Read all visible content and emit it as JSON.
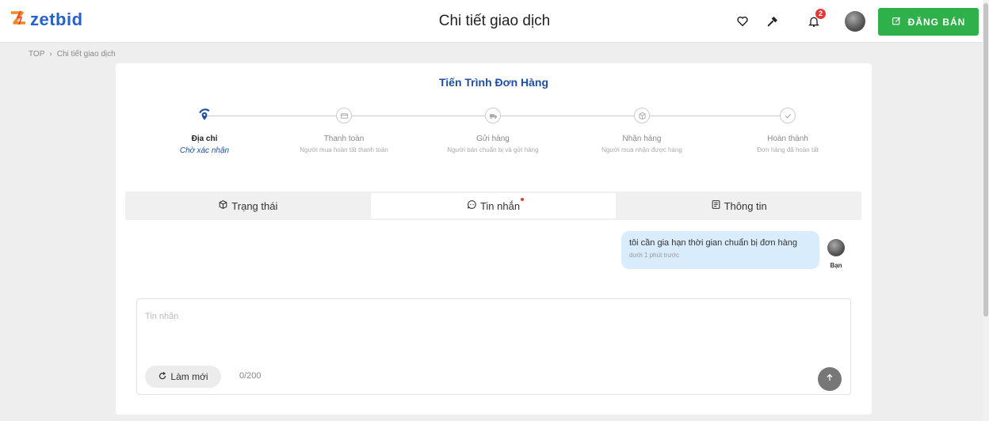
{
  "header": {
    "logo_text": "zetbid",
    "title": "Chi tiết giao dịch",
    "notification_count": "2",
    "sell_button_label": "ĐĂNG BÁN",
    "icons": [
      "heart-icon",
      "gavel-icon",
      "bell-icon",
      "avatar",
      "edit-icon"
    ]
  },
  "breadcrumb": {
    "items": [
      "TOP",
      "Chi tiết giao dịch"
    ],
    "separator": "›"
  },
  "progress": {
    "title": "Tiến Trình Đơn Hàng",
    "steps": [
      {
        "name": "Địa chỉ",
        "desc": "Chờ xác nhận",
        "icon": "location-icon",
        "active": true
      },
      {
        "name": "Thanh toán",
        "desc": "Người mua hoàn tất thanh toán",
        "icon": "card-icon",
        "active": false
      },
      {
        "name": "Gửi hàng",
        "desc": "Người bán chuẩn bị và gửi hàng",
        "icon": "truck-icon",
        "active": false
      },
      {
        "name": "Nhận hàng",
        "desc": "Người mua nhận được hàng",
        "icon": "box-icon",
        "active": false
      },
      {
        "name": "Hoàn thành",
        "desc": "Đơn hàng đã hoàn tất",
        "icon": "check-icon",
        "active": false
      }
    ]
  },
  "tabs": [
    {
      "label": "Trạng thái",
      "icon": "package-icon",
      "active": false
    },
    {
      "label": "Tin nhắn",
      "icon": "chat-icon",
      "active": true,
      "has_dot": true
    },
    {
      "label": "Thông tin",
      "icon": "document-icon",
      "active": false
    }
  ],
  "messages": [
    {
      "text": "tôi cần gia hạn thời gian chuẩn bị đơn hàng",
      "time": "dưới 1 phút trước",
      "sender": "Bạn"
    }
  ],
  "composer": {
    "placeholder": "Tin nhắn",
    "value": "",
    "refresh_label": "Làm mới",
    "char_count": "0/200"
  },
  "colors": {
    "brand": "#2563c9",
    "sell_button": "#2eb04b",
    "accent_text": "#1f4fa3",
    "bubble": "#d9ecfb",
    "badge": "#e53935"
  }
}
